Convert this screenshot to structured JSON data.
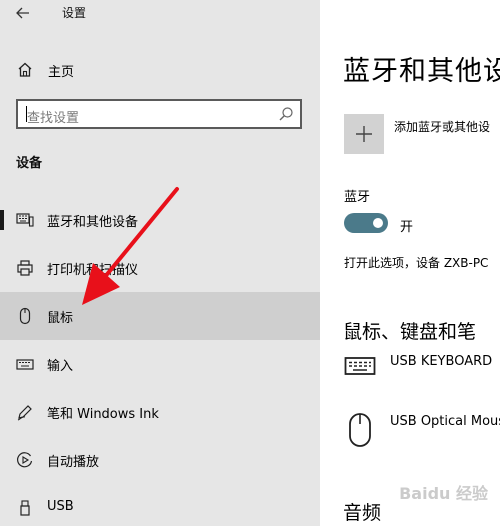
{
  "window": {
    "title": "设置"
  },
  "sidebar": {
    "home_label": "主页",
    "search_placeholder": "查找设置",
    "section_title": "设备",
    "items": [
      {
        "label": "蓝牙和其他设备",
        "icon": "bluetooth-devices-icon"
      },
      {
        "label": "打印机和扫描仪",
        "icon": "printer-icon"
      },
      {
        "label": "鼠标",
        "icon": "mouse-icon",
        "selected": true
      },
      {
        "label": "输入",
        "icon": "keyboard-icon"
      },
      {
        "label": "笔和 Windows Ink",
        "icon": "pen-icon"
      },
      {
        "label": "自动播放",
        "icon": "autoplay-icon"
      },
      {
        "label": "USB",
        "icon": "usb-icon"
      }
    ]
  },
  "main": {
    "title": "蓝牙和其他设",
    "add_device_label": "添加蓝牙或其他设",
    "bluetooth_label": "蓝牙",
    "bluetooth_state": "开",
    "bluetooth_on": true,
    "discoverable_text": "打开此选项，设备 ZXB-PC",
    "group_heading": "鼠标、键盘和笔",
    "devices": [
      {
        "name": "USB KEYBOARD",
        "icon": "keyboard-icon"
      },
      {
        "name": "USB Optical Mous",
        "icon": "mouse-icon"
      }
    ],
    "audio_heading": "音频"
  },
  "watermark": "Baidu 经验",
  "colors": {
    "sidebar_bg": "#e6e6e6",
    "selected_bg": "#cfcfcf",
    "toggle_on": "#4b7a8a",
    "annotation_arrow": "#e8101a"
  }
}
